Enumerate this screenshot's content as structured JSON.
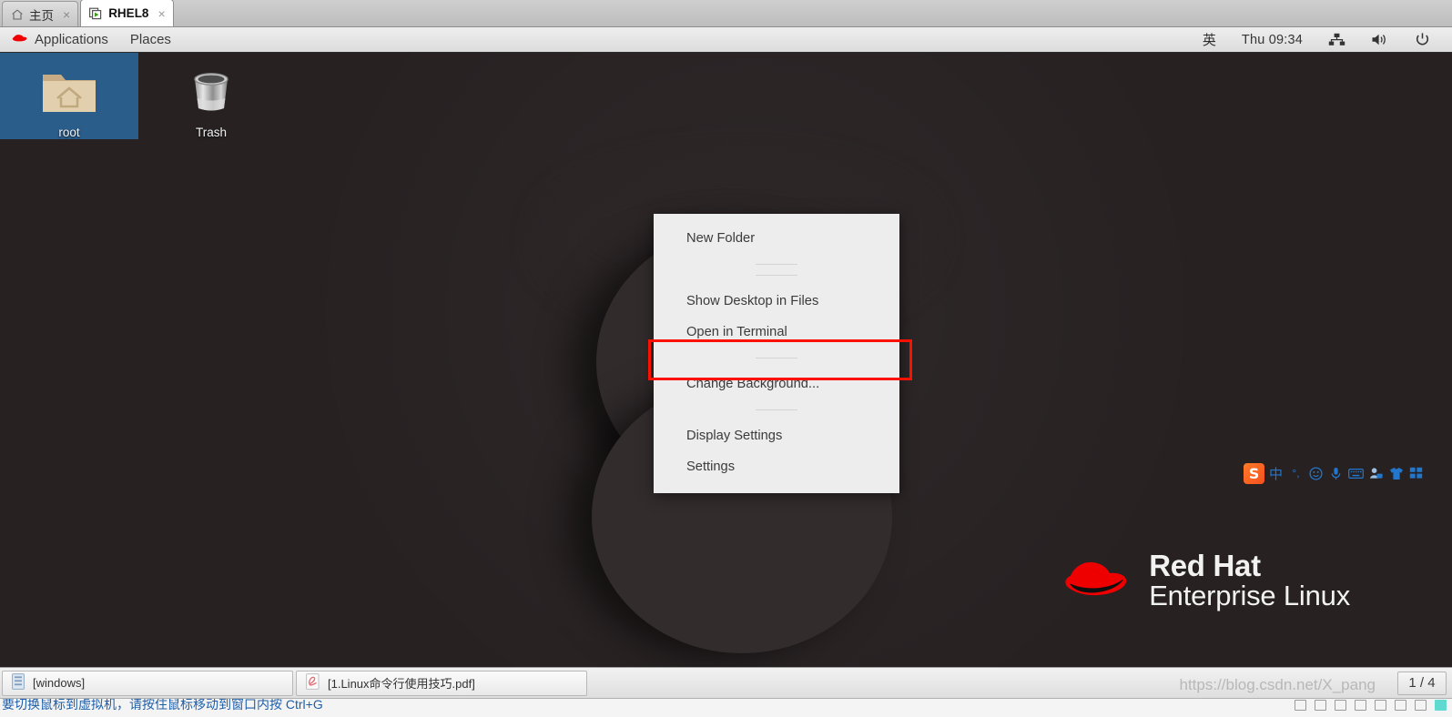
{
  "vm_tabs": [
    {
      "label": "主页",
      "icon": "home-icon",
      "active": false,
      "close": "×"
    },
    {
      "label": "RHEL8",
      "icon": "virtual-machine-icon",
      "active": true,
      "close": "×"
    }
  ],
  "gnome_panel": {
    "applications_label": "Applications",
    "places_label": "Places",
    "redhat_icon": "redhat-logo-icon",
    "input_method_label": "英",
    "clock": "Thu 09:34",
    "network_icon": "network-icon",
    "volume_icon": "volume-icon",
    "power_icon": "power-icon"
  },
  "desktop": {
    "icons": [
      {
        "label": "root",
        "icon": "home-folder-icon",
        "selected": true
      },
      {
        "label": "Trash",
        "icon": "trash-icon",
        "selected": false
      }
    ],
    "branding": {
      "logo": "red-hat-fedora-logo",
      "line1": "Red Hat",
      "line2": "Enterprise Linux",
      "logo_color": "#ee0000"
    }
  },
  "context_menu": {
    "items": [
      {
        "type": "item",
        "label": "New Folder"
      },
      {
        "type": "separator"
      },
      {
        "type": "separator"
      },
      {
        "type": "item",
        "label": "Show Desktop in Files"
      },
      {
        "type": "item",
        "label": "Open in Terminal",
        "highlighted": true
      },
      {
        "type": "separator"
      },
      {
        "type": "item",
        "label": "Change Background..."
      },
      {
        "type": "separator"
      },
      {
        "type": "item",
        "label": "Display Settings"
      },
      {
        "type": "item",
        "label": "Settings"
      }
    ],
    "highlight_color": "#fc1000"
  },
  "ime_toolbar": {
    "logo_text": "S",
    "mode_label": "中",
    "punctuation_label": "°,",
    "emoji_icon": "emoji-icon",
    "voice_icon": "microphone-icon",
    "keyboard_icon": "keyboard-icon",
    "account_icon": "account-icon",
    "skin_icon": "tshirt-skin-icon",
    "more_icon": "grid-more-icon",
    "accent_color": "#2277cc"
  },
  "taskbar": {
    "buttons": [
      {
        "label": "[windows]",
        "icon": "window-icon"
      },
      {
        "label": "[1.Linux命令行使用技巧.pdf]",
        "icon": "pdf-icon"
      }
    ],
    "page_indicator": "1 / 4"
  },
  "watermark": "https://blog.csdn.net/X_pang",
  "bottom_strip": {
    "clipped_text": "要切换鼠标到虚拟机，请按住鼠标移动到窗口内按 Ctrl+G"
  }
}
